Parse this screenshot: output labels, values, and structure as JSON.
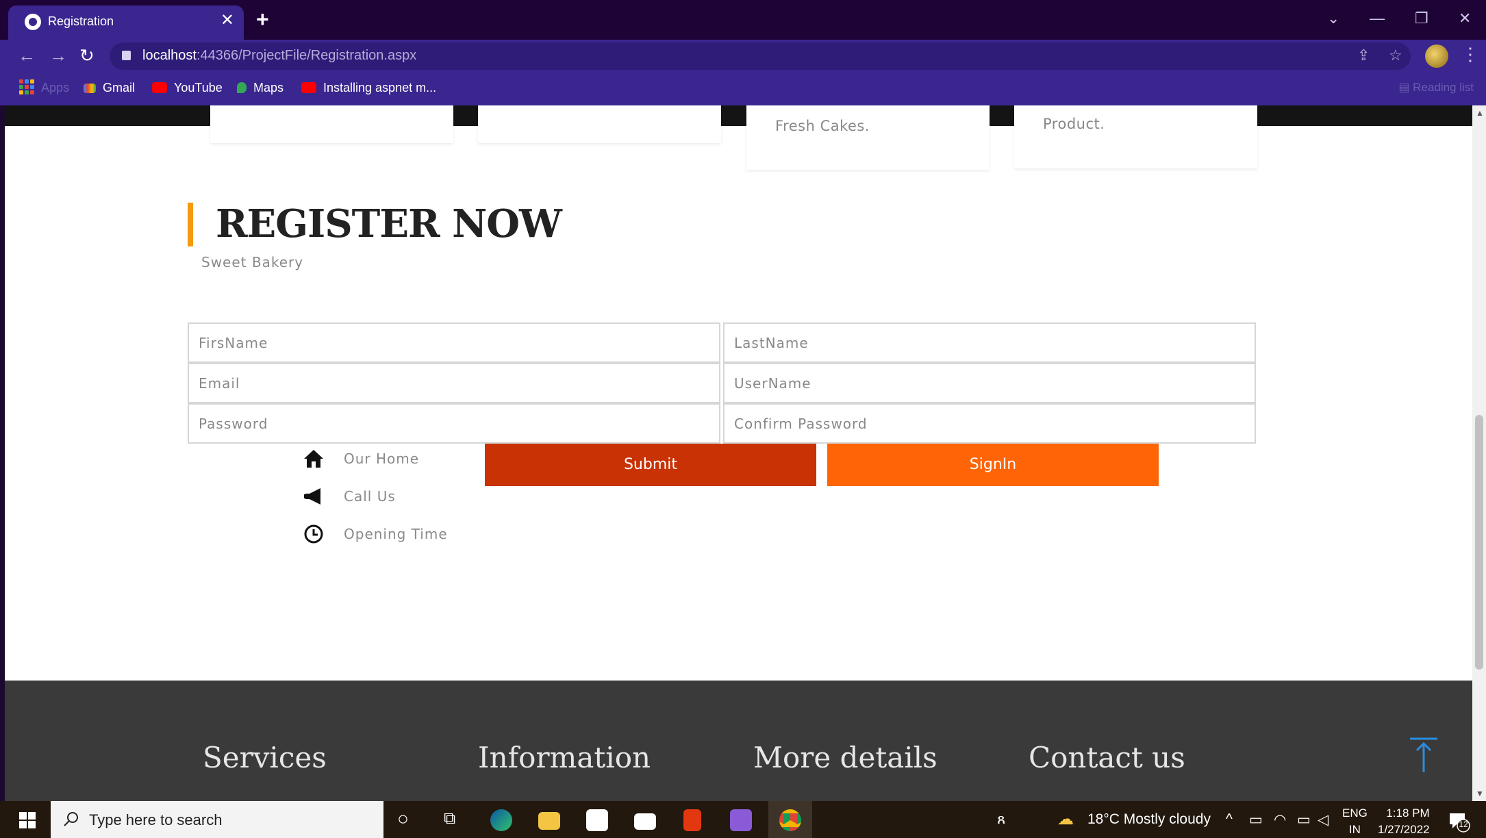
{
  "browser": {
    "tab_title": "Registration",
    "url_host": "localhost",
    "url_rest": ":44366/ProjectFile/Registration.aspx",
    "bookmarks": [
      {
        "label": "Apps"
      },
      {
        "label": "Gmail"
      },
      {
        "label": "YouTube"
      },
      {
        "label": "Maps"
      },
      {
        "label": "Installing aspnet m..."
      }
    ],
    "reading_list": "Reading list"
  },
  "features": {
    "card3_text": "Fresh Cakes.",
    "card4_text": "Product."
  },
  "register": {
    "title": "REGISTER NOW",
    "subtitle": "Sweet Bakery",
    "fields": {
      "first_name": "FirsName",
      "last_name": "LastName",
      "email": "Email",
      "username": "UserName",
      "password": "Password",
      "confirm_password": "Confirm Password"
    },
    "submit_label": "Submit",
    "signin_label": "SignIn",
    "submit_color": "#c83204",
    "signin_color": "#ff6406"
  },
  "side_links": [
    {
      "label": "Our Home",
      "icon": "home-icon"
    },
    {
      "label": "Call Us",
      "icon": "megaphone-icon"
    },
    {
      "label": "Opening Time",
      "icon": "clock-icon"
    }
  ],
  "footer": {
    "columns": [
      "Services",
      "Information",
      "More details",
      "Contact us"
    ]
  },
  "taskbar": {
    "search_placeholder": "Type here to search",
    "weather": "18°C  Mostly cloudy",
    "lang_top": "ENG",
    "lang_bottom": "IN",
    "time": "1:18 PM",
    "date": "1/27/2022",
    "notification_count": "12"
  }
}
